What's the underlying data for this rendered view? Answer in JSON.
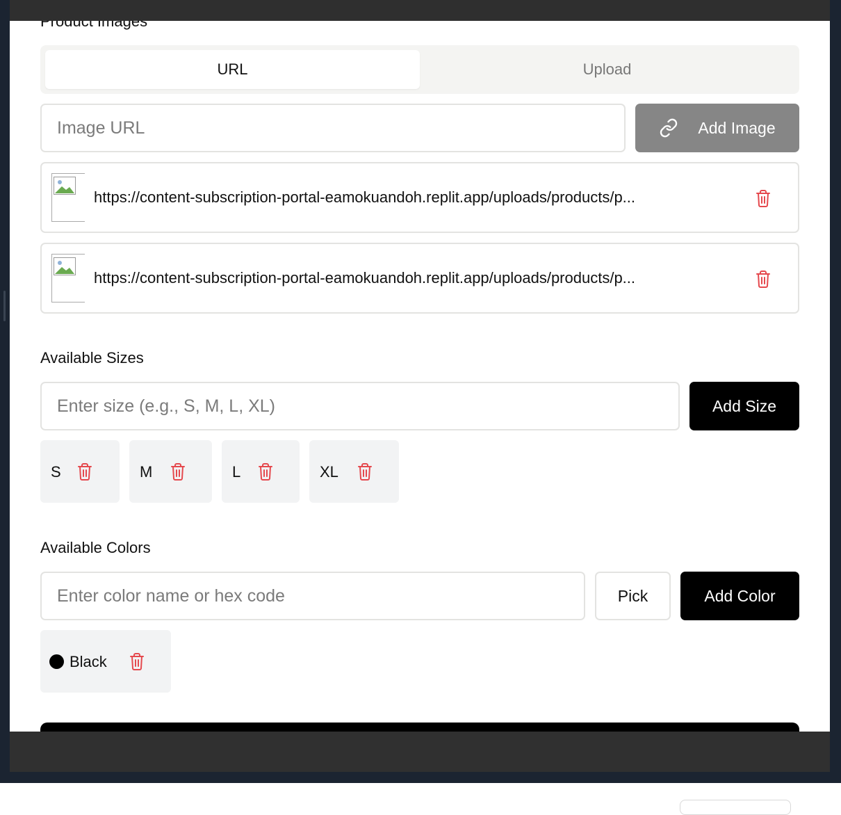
{
  "images": {
    "section_title": "Product Images",
    "tabs": [
      "URL",
      "Upload"
    ],
    "url_placeholder": "Image URL",
    "add_button": "Add Image",
    "items": [
      "https://content-subscription-portal-eamokuandoh.replit.app/uploads/products/p...",
      "https://content-subscription-portal-eamokuandoh.replit.app/uploads/products/p..."
    ]
  },
  "sizes": {
    "section_title": "Available Sizes",
    "placeholder": "Enter size (e.g., S, M, L, XL)",
    "add_button": "Add Size",
    "items": [
      "S",
      "M",
      "L",
      "XL"
    ]
  },
  "colors": {
    "section_title": "Available Colors",
    "placeholder": "Enter color name or hex code",
    "pick_button": "Pick",
    "add_button": "Add Color",
    "items": [
      {
        "name": "Black",
        "swatch": "#000000"
      }
    ]
  },
  "theme": {
    "danger": "#e5484d",
    "primary": "#000000",
    "muted_button": "#868686"
  }
}
